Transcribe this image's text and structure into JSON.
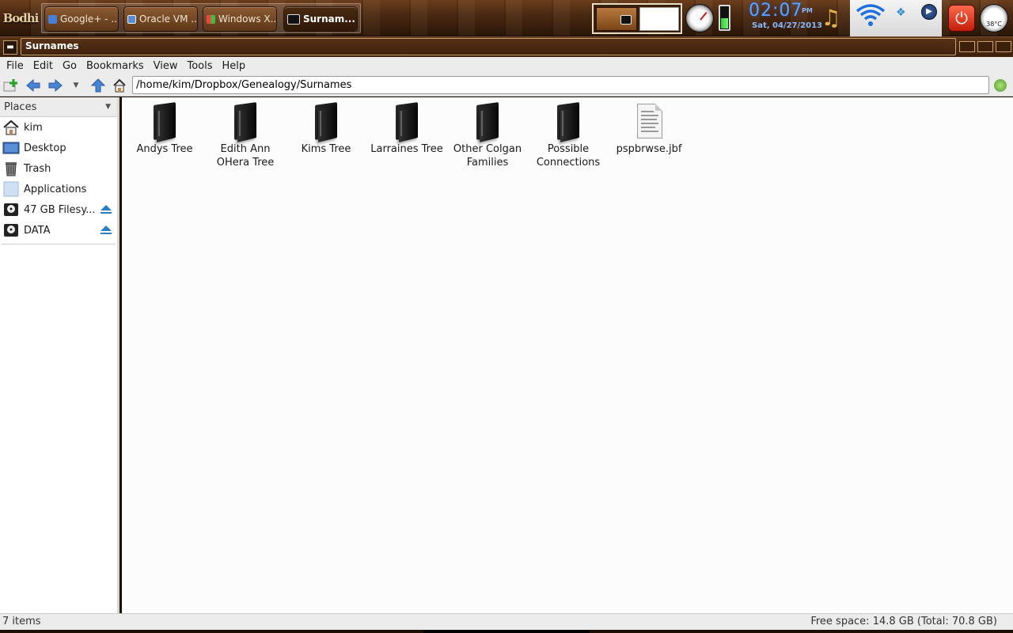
{
  "panel": {
    "logo": "Bodhi",
    "tasks": [
      {
        "label": "Google+ - ...",
        "icon": "browser-icon",
        "active": false
      },
      {
        "label": "Oracle VM ...",
        "icon": "virtualbox-icon",
        "active": false
      },
      {
        "label": "Windows X...",
        "icon": "windows-icon",
        "active": false
      },
      {
        "label": "Surnam...",
        "icon": "file-manager-icon",
        "active": true
      }
    ],
    "clock": {
      "time": "02:07",
      "ampm": "PM",
      "date": "Sat, 04/27/2013"
    },
    "temperature": "38°C",
    "battery_level": 0.45
  },
  "window": {
    "title": "Surnames"
  },
  "menu": [
    "File",
    "Edit",
    "Go",
    "Bookmarks",
    "View",
    "Tools",
    "Help"
  ],
  "location": {
    "path": "/home/kim/Dropbox/Genealogy/Surnames"
  },
  "sidebar": {
    "header": "Places",
    "items": [
      {
        "label": "kim",
        "icon": "home-icon",
        "eject": false
      },
      {
        "label": "Desktop",
        "icon": "desktop-icon",
        "eject": false
      },
      {
        "label": "Trash",
        "icon": "trash-icon",
        "eject": false
      },
      {
        "label": "Applications",
        "icon": "applications-icon",
        "eject": false
      },
      {
        "label": "47 GB Filesy...",
        "icon": "drive-icon",
        "eject": true
      },
      {
        "label": "DATA",
        "icon": "drive-icon",
        "eject": true
      }
    ]
  },
  "files": [
    {
      "name": "Andys Tree",
      "type": "folder"
    },
    {
      "name": "Edith Ann OHera Tree",
      "type": "folder"
    },
    {
      "name": "Kims Tree",
      "type": "folder"
    },
    {
      "name": "Larraines Tree",
      "type": "folder"
    },
    {
      "name": "Other Colgan Families",
      "type": "folder"
    },
    {
      "name": "Possible Connections",
      "type": "folder"
    },
    {
      "name": "pspbrwse.jbf",
      "type": "file"
    }
  ],
  "status": {
    "items": "7 items",
    "free_space": "Free space: 14.8 GB (Total: 70.8 GB)"
  },
  "colors": {
    "panel_wood": "#4a2912",
    "clock_blue": "#5ea2ff",
    "eject_blue": "#2a7fc2"
  }
}
